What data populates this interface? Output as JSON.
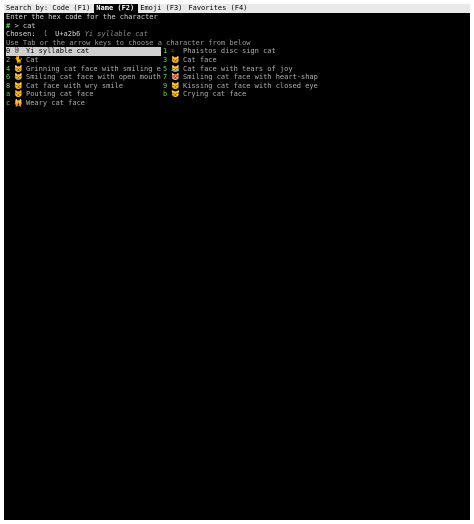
{
  "tabs": [
    {
      "label": "Search by: Code (F1)",
      "active": false
    },
    {
      "label": "Name (F2)",
      "active": true
    },
    {
      "label": "Emoji (F3)",
      "active": false
    },
    {
      "label": "Favorites (F4)",
      "active": false
    }
  ],
  "instruction": "Enter the hex code for the character",
  "input": {
    "prompt_symbol": "#",
    "prompt_arrow": ">",
    "value": "cat"
  },
  "chosen": {
    "label": "Chosen:",
    "glyph": "ꪶ",
    "code": "U+a2b6",
    "name": "Yi syllable cat"
  },
  "hint": "Use Tab or the arrow keys to choose a character from below",
  "results": [
    {
      "key": "0",
      "glyph": "ꊶ",
      "name": "Yi syllable cat",
      "selected": true
    },
    {
      "key": "1",
      "glyph": "𐇬",
      "name": "Phaistos disc sign cat",
      "selected": false
    },
    {
      "key": "2",
      "glyph": "🐈",
      "name": "Cat",
      "selected": false
    },
    {
      "key": "3",
      "glyph": "🐱",
      "name": "Cat face",
      "selected": false
    },
    {
      "key": "4",
      "glyph": "😺",
      "name": "Grinning cat face with smiling e…",
      "selected": false
    },
    {
      "key": "5",
      "glyph": "😹",
      "name": "Cat face with tears of joy",
      "selected": false
    },
    {
      "key": "6",
      "glyph": "😸",
      "name": "Smiling cat face with open mouth",
      "selected": false
    },
    {
      "key": "7",
      "glyph": "😻",
      "name": "Smiling cat face with heart-shap…",
      "selected": false
    },
    {
      "key": "8",
      "glyph": "😼",
      "name": "Cat face with wry smile",
      "selected": false
    },
    {
      "key": "9",
      "glyph": "😽",
      "name": "Kissing cat face with closed eyes",
      "selected": false
    },
    {
      "key": "a",
      "glyph": "😾",
      "name": "Pouting cat face",
      "selected": false
    },
    {
      "key": "b",
      "glyph": "😿",
      "name": "Crying cat face",
      "selected": false
    },
    {
      "key": "c",
      "glyph": "🙀",
      "name": "Weary cat face",
      "selected": false
    }
  ]
}
